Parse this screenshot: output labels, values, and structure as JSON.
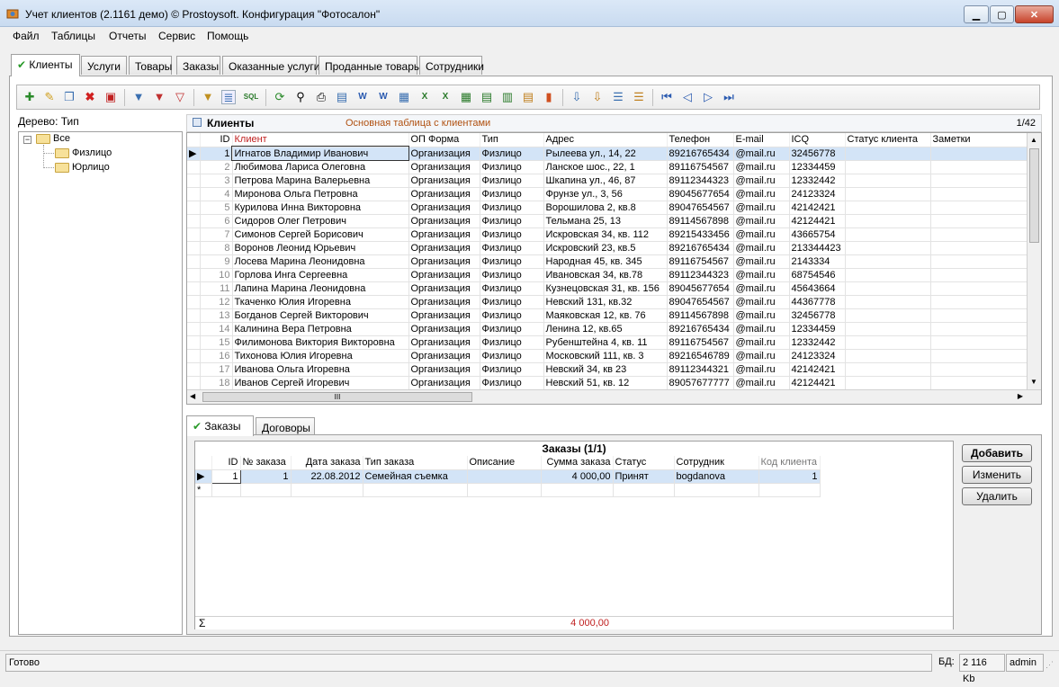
{
  "window": {
    "title": "Учет клиентов (2.1161 демо) © Prostoysoft. Конфигурация \"Фотосалон\"",
    "minimize": "▁",
    "maximize": "▢",
    "close": "✕"
  },
  "menu": [
    "Файл",
    "Таблицы",
    "Отчеты",
    "Сервис",
    "Помощь"
  ],
  "tabs": [
    {
      "label": "Клиенты",
      "active": true
    },
    {
      "label": "Услуги"
    },
    {
      "label": "Товары"
    },
    {
      "label": "Заказы"
    },
    {
      "label": "Оказанные услуги"
    },
    {
      "label": "Проданные товары"
    },
    {
      "label": "Сотрудники"
    }
  ],
  "toolbar": {
    "icons": [
      "add-record-icon",
      "edit-icon",
      "copy-icon",
      "delete-icon",
      "delete-all-icon",
      "filter-icon",
      "filter-clear-icon",
      "filter-remove-icon",
      "tree-filter-icon",
      "group-icon",
      "sql-icon",
      "refresh-icon",
      "find-icon",
      "print-icon",
      "preview-icon",
      "export-word-icon",
      "export-word2-icon",
      "export-html-icon",
      "export-excel-icon",
      "export-excel2-icon",
      "export-csv-icon",
      "export-xml-icon",
      "export-txt-icon",
      "chart-icon",
      "import-icon",
      "import2-icon",
      "list-icon",
      "list2-icon",
      "first-record-icon",
      "prev-record-icon",
      "next-record-icon",
      "last-record-icon"
    ]
  },
  "tree": {
    "label": "Дерево: Тип",
    "root": "Все",
    "children": [
      "Физлицо",
      "Юрлицо"
    ]
  },
  "clients": {
    "title": "Клиенты",
    "subtitle": "Основная таблица с клиентами",
    "counter": "1/42",
    "columns": [
      "ID",
      "Клиент",
      "ОП Форма",
      "Тип",
      "Адрес",
      "Телефон",
      "E-mail",
      "ICQ",
      "Статус клиента",
      "Заметки"
    ],
    "rows": [
      [
        "1",
        "Игнатов Владимир Иванович",
        "Организация",
        "Физлицо",
        "Рылеева ул., 14, 22",
        "89216765434",
        "@mail.ru",
        "32456778",
        "",
        ""
      ],
      [
        "2",
        "Любимова Лариса Олеговна",
        "Организация",
        "Физлицо",
        "Ланское шос., 22, 1",
        "89116754567",
        "@mail.ru",
        "12334459",
        "",
        ""
      ],
      [
        "3",
        "Петрова Марина Валерьевна",
        "Организация",
        "Физлицо",
        "Шкапина ул., 46, 87",
        "89112344323",
        "@mail.ru",
        "12332442",
        "",
        ""
      ],
      [
        "4",
        "Миронова Ольга Петровна",
        "Организация",
        "Физлицо",
        "Фрунзе ул., 3, 56",
        "89045677654",
        "@mail.ru",
        "24123324",
        "",
        ""
      ],
      [
        "5",
        "Курилова Инна Викторовна",
        "Организация",
        "Физлицо",
        "Ворошилова 2, кв.8",
        "89047654567",
        "@mail.ru",
        "42142421",
        "",
        ""
      ],
      [
        "6",
        "Сидоров Олег Петрович",
        "Организация",
        "Физлицо",
        "Тельмана 25, 13",
        "89114567898",
        "@mail.ru",
        "42124421",
        "",
        ""
      ],
      [
        "7",
        "Симонов Сергей Борисович",
        "Организация",
        "Физлицо",
        "Искровская 34, кв. 112",
        "89215433456",
        "@mail.ru",
        "43665754",
        "",
        ""
      ],
      [
        "8",
        "Воронов Леонид Юрьевич",
        "Организация",
        "Физлицо",
        "Искровский 23, кв.5",
        "89216765434",
        "@mail.ru",
        "213344423",
        "",
        ""
      ],
      [
        "9",
        "Лосева Марина Леонидовна",
        "Организация",
        "Физлицо",
        "Народная 45, кв. 345",
        "89116754567",
        "@mail.ru",
        "2143334",
        "",
        ""
      ],
      [
        "10",
        "Горлова Инга Сергеевна",
        "Организация",
        "Физлицо",
        "Ивановская 34, кв.78",
        "89112344323",
        "@mail.ru",
        "68754546",
        "",
        ""
      ],
      [
        "11",
        "Лапина Марина Леонидовна",
        "Организация",
        "Физлицо",
        "Кузнецовская 31, кв. 156",
        "89045677654",
        "@mail.ru",
        "45643664",
        "",
        ""
      ],
      [
        "12",
        "Ткаченко Юлия Игоревна",
        "Организация",
        "Физлицо",
        "Невский 131, кв.32",
        "89047654567",
        "@mail.ru",
        "44367778",
        "",
        ""
      ],
      [
        "13",
        "Богданов Сергей Викторович",
        "Организация",
        "Физлицо",
        "Маяковская 12, кв. 76",
        "89114567898",
        "@mail.ru",
        "32456778",
        "",
        ""
      ],
      [
        "14",
        "Калинина Вера Петровна",
        "Организация",
        "Физлицо",
        "Ленина 12, кв.65",
        "89216765434",
        "@mail.ru",
        "12334459",
        "",
        ""
      ],
      [
        "15",
        "Филимонова Виктория Викторовна",
        "Организация",
        "Физлицо",
        "Рубенштейна 4, кв. 11",
        "89116754567",
        "@mail.ru",
        "12332442",
        "",
        ""
      ],
      [
        "16",
        "Тихонова Юлия Игоревна",
        "Организация",
        "Физлицо",
        "Московский 111, кв. 3",
        "89216546789",
        "@mail.ru",
        "24123324",
        "",
        ""
      ],
      [
        "17",
        "Иванова Ольга Игоревна",
        "Организация",
        "Физлицо",
        "Невский 34, кв 23",
        "89112344321",
        "@mail.ru",
        "42142421",
        "",
        ""
      ],
      [
        "18",
        "Иванов Сергей Игоревич",
        "Организация",
        "Физлицо",
        "Невский 51, кв. 12",
        "89057677777",
        "@mail.ru",
        "42124421",
        "",
        ""
      ]
    ],
    "hscroll_label": "III"
  },
  "lower_tabs": [
    {
      "label": "Заказы",
      "active": true
    },
    {
      "label": "Договоры"
    }
  ],
  "orders": {
    "title": "Заказы (1/1)",
    "columns": [
      "ID",
      "№ заказа",
      "Дата заказа",
      "Тип заказа",
      "Описание",
      "Сумма заказа",
      "Статус",
      "Сотрудник",
      "Код клиента"
    ],
    "rows": [
      [
        "1",
        "1",
        "22.08.2012",
        "Семейная съемка",
        "",
        "4 000,00",
        "Принят",
        "bogdanova",
        "1"
      ]
    ],
    "new_row_marker": "*",
    "sum_symbol": "Σ",
    "total": "4 000,00"
  },
  "buttons": {
    "add": "Добавить",
    "edit": "Изменить",
    "delete": "Удалить"
  },
  "status": {
    "text": "Готово",
    "db_label": "БД:",
    "db_size": "2 116 Kb",
    "user": "admin"
  }
}
